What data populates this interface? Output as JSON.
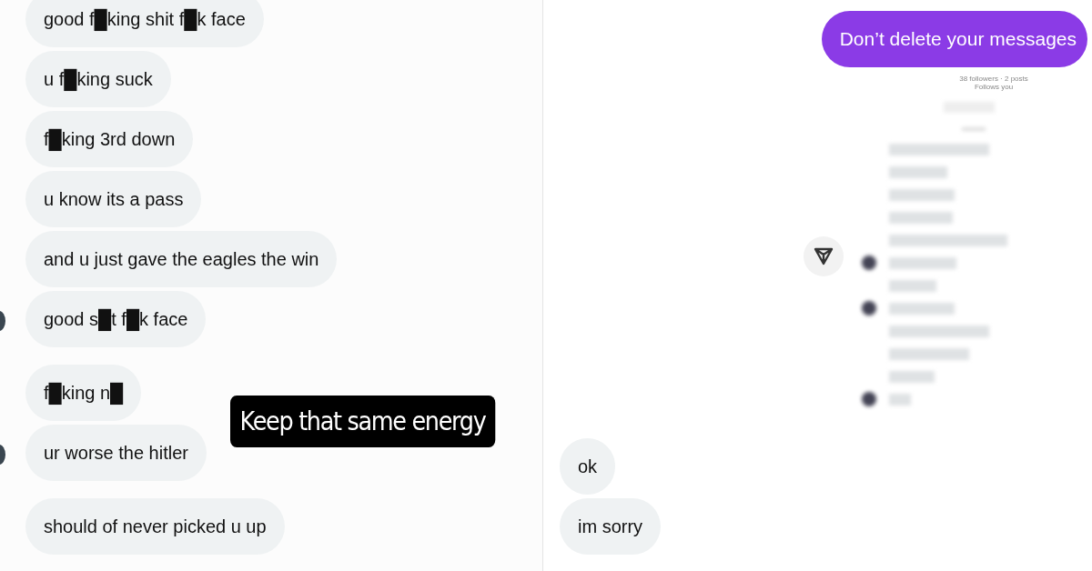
{
  "left_thread": {
    "groups": [
      {
        "messages": [
          {
            "text": "good f█king shit f█k face",
            "avatar": false
          },
          {
            "text": "u f█king suck",
            "avatar": false
          },
          {
            "text": "f█king 3rd down",
            "avatar": false
          },
          {
            "text": "u know its a pass",
            "avatar": false
          },
          {
            "text": "and u just gave the eagles the win",
            "avatar": false
          },
          {
            "text": "good s█t f█k face",
            "avatar": true
          }
        ]
      },
      {
        "messages": [
          {
            "text": "f█king n█",
            "avatar": false
          },
          {
            "text": "ur worse the hitler",
            "avatar": true
          }
        ]
      },
      {
        "messages": [
          {
            "text": "should of never picked u up",
            "avatar": false
          }
        ]
      }
    ]
  },
  "sticker": {
    "text": "Keep that same energy"
  },
  "right_thread": {
    "sent_message": "Don’t delete your messages",
    "profile": {
      "stats": "38 followers · 2 posts",
      "follows": "Follows you"
    },
    "replies": [
      {
        "text": "ok"
      },
      {
        "text": "im sorry"
      }
    ]
  }
}
